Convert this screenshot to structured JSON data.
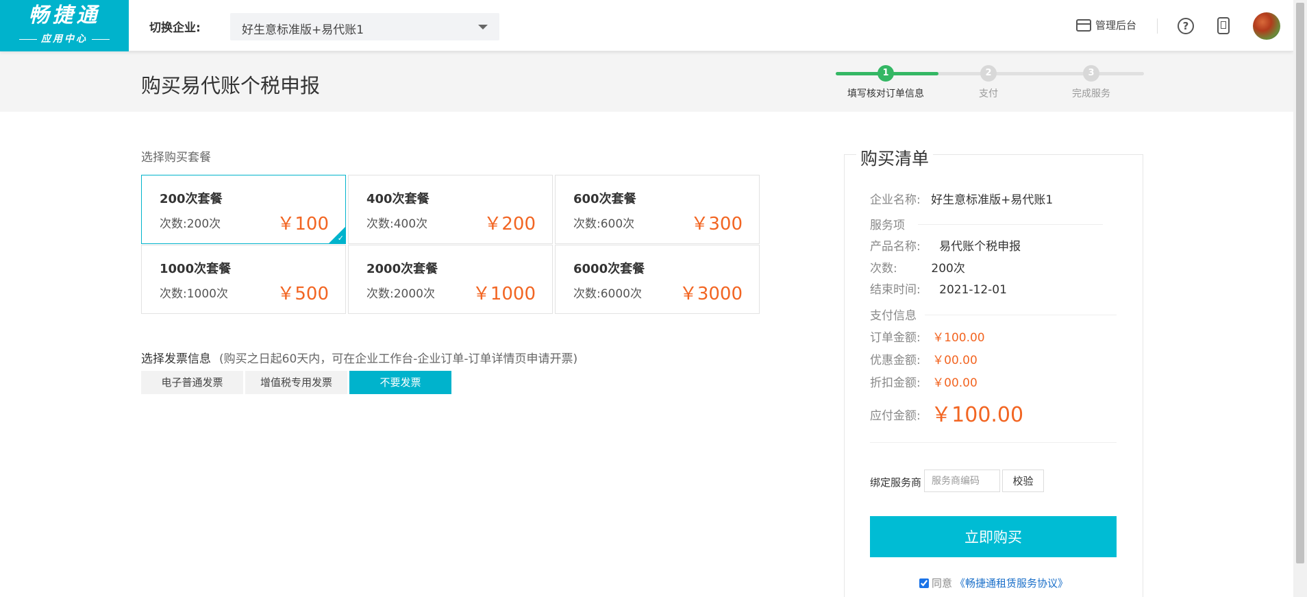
{
  "header": {
    "logo_main": "畅捷通",
    "logo_sub": "应用中心",
    "switch_label": "切换企业:",
    "company_selected": "好生意标准版+易代账1",
    "admin_label": "管理后台",
    "help_glyph": "?"
  },
  "page": {
    "title": "购买易代账个税申报"
  },
  "steps": [
    {
      "num": "1",
      "label": "填写核对订单信息",
      "active": true
    },
    {
      "num": "2",
      "label": "支付",
      "active": false
    },
    {
      "num": "3",
      "label": "完成服务",
      "active": false
    }
  ],
  "packages": {
    "section_label": "选择购买套餐",
    "selected_index": 0,
    "items": [
      {
        "name": "200次套餐",
        "count": "次数:200次",
        "price": "￥100"
      },
      {
        "name": "400次套餐",
        "count": "次数:400次",
        "price": "￥200"
      },
      {
        "name": "600次套餐",
        "count": "次数:600次",
        "price": "￥300"
      },
      {
        "name": "1000次套餐",
        "count": "次数:1000次",
        "price": "￥500"
      },
      {
        "name": "2000次套餐",
        "count": "次数:2000次",
        "price": "￥1000"
      },
      {
        "name": "6000次套餐",
        "count": "次数:6000次",
        "price": "￥3000"
      }
    ],
    "check_glyph": "✓"
  },
  "invoice": {
    "title": "选择发票信息",
    "note": "(购买之日起60天内，可在企业工作台-企业订单-订单详情页申请开票)",
    "options": [
      "电子普通发票",
      "增值税专用发票",
      "不要发票"
    ],
    "selected_index": 2
  },
  "summary": {
    "title": "购买清单",
    "company_label": "企业名称:",
    "company_value": "好生意标准版+易代账1",
    "service_group": "服务项",
    "product_label": "产品名称:",
    "product_value": "易代账个税申报",
    "count_label": "次数:",
    "count_value": "200次",
    "end_label": "结束时间:",
    "end_value": "2021-12-01",
    "pay_group": "支付信息",
    "order_amount_label": "订单金额:",
    "order_amount_value": "￥100.00",
    "discount_label": "优惠金额:",
    "discount_value": "￥00.00",
    "rebate_label": "折扣金额:",
    "rebate_value": "￥00.00",
    "payable_label": "应付金额:",
    "payable_value": "￥100.00",
    "bind_label": "绑定服务商",
    "bind_placeholder": "服务商编码",
    "verify_label": "校验",
    "buy_label": "立即购买",
    "agree_text": "同意",
    "agree_link": "《畅捷通租赁服务协议》",
    "agree_checked": true
  },
  "colors": {
    "brand": "#00b3cc",
    "step_done": "#34b764",
    "price": "#f26522"
  }
}
